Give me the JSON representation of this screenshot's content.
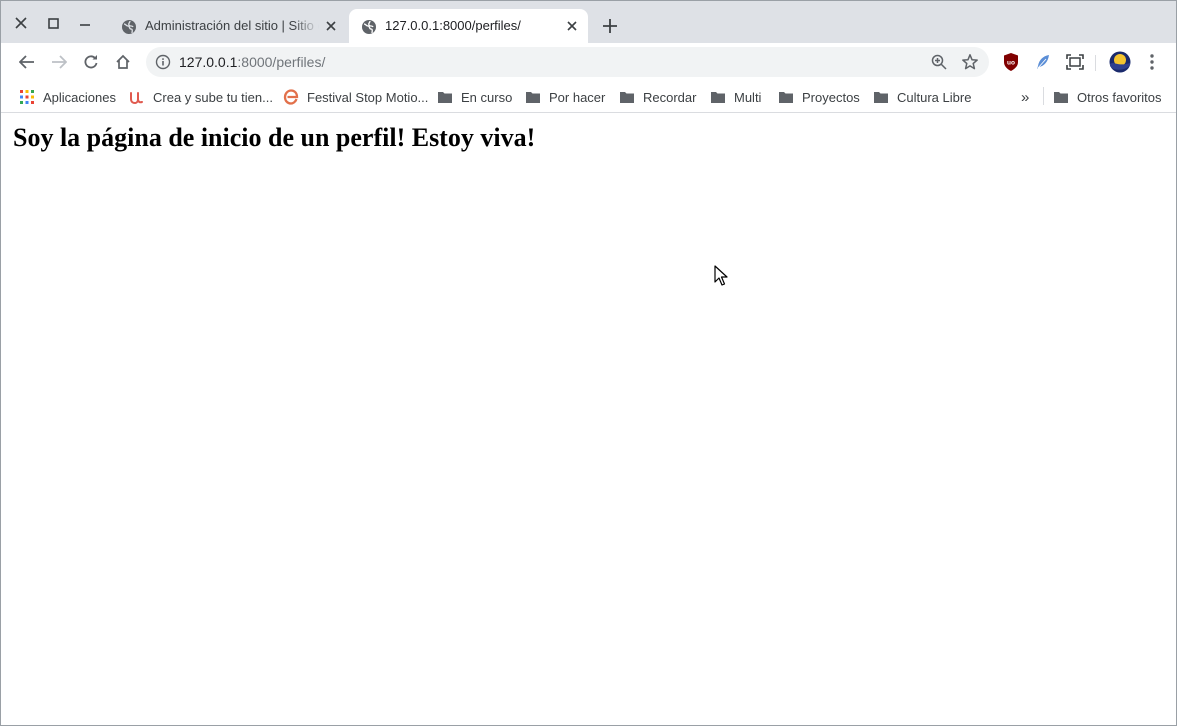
{
  "tabs": [
    {
      "title": "Administración del sitio | Sitio de administración de Django",
      "active": false
    },
    {
      "title": "127.0.0.1:8000/perfiles/",
      "active": true
    }
  ],
  "omnibox": {
    "url_host": "127.0.0.1",
    "url_rest": ":8000/perfiles/"
  },
  "bookmarks": {
    "apps_label": "Aplicaciones",
    "items": [
      {
        "label": "Crea y sube tu tien...",
        "icon": "udemy-icon"
      },
      {
        "label": "Festival Stop Motio...",
        "icon": "e-site-icon"
      },
      {
        "label": "En curso",
        "icon": "folder-icon"
      },
      {
        "label": "Por hacer",
        "icon": "folder-icon"
      },
      {
        "label": "Recordar",
        "icon": "folder-icon"
      },
      {
        "label": "Multi",
        "icon": "folder-icon"
      },
      {
        "label": "Proyectos",
        "icon": "folder-icon"
      },
      {
        "label": "Cultura Libre",
        "icon": "folder-icon"
      }
    ],
    "overflow": "»",
    "other_label": "Otros favoritos"
  },
  "page": {
    "heading": "Soy la página de inicio de un perfil! Estoy viva!"
  },
  "colors": {
    "tabstrip": "#dee1e6",
    "omnibox": "#f1f3f4",
    "icon": "#5f6368",
    "folder": "#5f6368"
  }
}
